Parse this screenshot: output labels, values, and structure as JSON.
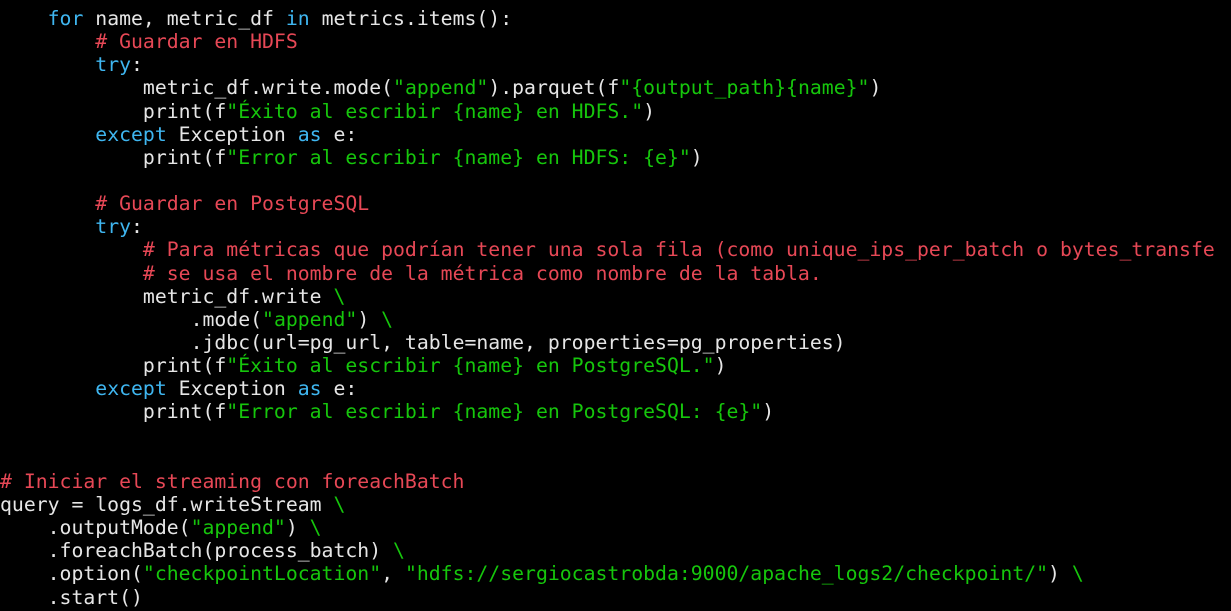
{
  "colors": {
    "background": "#000000",
    "plain": "#e6e6e6",
    "keyword": "#3fb6f0",
    "string": "#16c60c",
    "comment": "#e74856"
  },
  "lines": [
    {
      "indent": 4,
      "tokens": [
        {
          "t": "kw",
          "v": "for"
        },
        {
          "t": "plain",
          "v": " name, metric_df "
        },
        {
          "t": "kw",
          "v": "in"
        },
        {
          "t": "plain",
          "v": " metrics.items():"
        }
      ]
    },
    {
      "indent": 8,
      "tokens": [
        {
          "t": "cm",
          "v": "# Guardar en HDFS"
        }
      ]
    },
    {
      "indent": 8,
      "tokens": [
        {
          "t": "kw",
          "v": "try"
        },
        {
          "t": "plain",
          "v": ":"
        }
      ]
    },
    {
      "indent": 12,
      "tokens": [
        {
          "t": "plain",
          "v": "metric_df.write.mode("
        },
        {
          "t": "str",
          "v": "\"append\""
        },
        {
          "t": "plain",
          "v": ").parquet(f"
        },
        {
          "t": "str",
          "v": "\"{output_path}{name}\""
        },
        {
          "t": "plain",
          "v": ")"
        }
      ]
    },
    {
      "indent": 12,
      "tokens": [
        {
          "t": "plain",
          "v": "print(f"
        },
        {
          "t": "str",
          "v": "\"Éxito al escribir {name} en HDFS.\""
        },
        {
          "t": "plain",
          "v": ")"
        }
      ]
    },
    {
      "indent": 8,
      "tokens": [
        {
          "t": "kw",
          "v": "except"
        },
        {
          "t": "plain",
          "v": " Exception "
        },
        {
          "t": "kw",
          "v": "as"
        },
        {
          "t": "plain",
          "v": " e:"
        }
      ]
    },
    {
      "indent": 12,
      "tokens": [
        {
          "t": "plain",
          "v": "print(f"
        },
        {
          "t": "str",
          "v": "\"Error al escribir {name} en HDFS: {e}\""
        },
        {
          "t": "plain",
          "v": ")"
        }
      ]
    },
    {
      "indent": 0,
      "tokens": []
    },
    {
      "indent": 8,
      "tokens": [
        {
          "t": "cm",
          "v": "# Guardar en PostgreSQL"
        }
      ]
    },
    {
      "indent": 8,
      "tokens": [
        {
          "t": "kw",
          "v": "try"
        },
        {
          "t": "plain",
          "v": ":"
        }
      ]
    },
    {
      "indent": 12,
      "tokens": [
        {
          "t": "cm",
          "v": "# Para métricas que podrían tener una sola fila (como unique_ips_per_batch o bytes_transfe"
        }
      ]
    },
    {
      "indent": 12,
      "tokens": [
        {
          "t": "cm",
          "v": "# se usa el nombre de la métrica como nombre de la tabla."
        }
      ]
    },
    {
      "indent": 12,
      "tokens": [
        {
          "t": "plain",
          "v": "metric_df.write "
        },
        {
          "t": "str",
          "v": "\\"
        }
      ]
    },
    {
      "indent": 16,
      "tokens": [
        {
          "t": "plain",
          "v": ".mode("
        },
        {
          "t": "str",
          "v": "\"append\""
        },
        {
          "t": "plain",
          "v": ") "
        },
        {
          "t": "str",
          "v": "\\"
        }
      ]
    },
    {
      "indent": 16,
      "tokens": [
        {
          "t": "plain",
          "v": ".jdbc(url=pg_url, table=name, properties=pg_properties)"
        }
      ]
    },
    {
      "indent": 12,
      "tokens": [
        {
          "t": "plain",
          "v": "print(f"
        },
        {
          "t": "str",
          "v": "\"Éxito al escribir {name} en PostgreSQL.\""
        },
        {
          "t": "plain",
          "v": ")"
        }
      ]
    },
    {
      "indent": 8,
      "tokens": [
        {
          "t": "kw",
          "v": "except"
        },
        {
          "t": "plain",
          "v": " Exception "
        },
        {
          "t": "kw",
          "v": "as"
        },
        {
          "t": "plain",
          "v": " e:"
        }
      ]
    },
    {
      "indent": 12,
      "tokens": [
        {
          "t": "plain",
          "v": "print(f"
        },
        {
          "t": "str",
          "v": "\"Error al escribir {name} en PostgreSQL: {e}\""
        },
        {
          "t": "plain",
          "v": ")"
        }
      ]
    },
    {
      "indent": 0,
      "tokens": []
    },
    {
      "indent": 0,
      "tokens": []
    },
    {
      "indent": 0,
      "tokens": [
        {
          "t": "cm",
          "v": "# Iniciar el streaming con foreachBatch"
        }
      ]
    },
    {
      "indent": 0,
      "tokens": [
        {
          "t": "plain",
          "v": "query = logs_df.writeStream "
        },
        {
          "t": "str",
          "v": "\\"
        }
      ]
    },
    {
      "indent": 4,
      "tokens": [
        {
          "t": "plain",
          "v": ".outputMode("
        },
        {
          "t": "str",
          "v": "\"append\""
        },
        {
          "t": "plain",
          "v": ") "
        },
        {
          "t": "str",
          "v": "\\"
        }
      ]
    },
    {
      "indent": 4,
      "tokens": [
        {
          "t": "plain",
          "v": ".foreachBatch(process_batch) "
        },
        {
          "t": "str",
          "v": "\\"
        }
      ]
    },
    {
      "indent": 4,
      "tokens": [
        {
          "t": "plain",
          "v": ".option("
        },
        {
          "t": "str",
          "v": "\"checkpointLocation\""
        },
        {
          "t": "plain",
          "v": ", "
        },
        {
          "t": "str",
          "v": "\"hdfs://sergiocastrobda:9000/apache_logs2/checkpoint/\""
        },
        {
          "t": "plain",
          "v": ") "
        },
        {
          "t": "str",
          "v": "\\"
        }
      ]
    },
    {
      "indent": 4,
      "tokens": [
        {
          "t": "plain",
          "v": ".start()"
        }
      ]
    }
  ]
}
